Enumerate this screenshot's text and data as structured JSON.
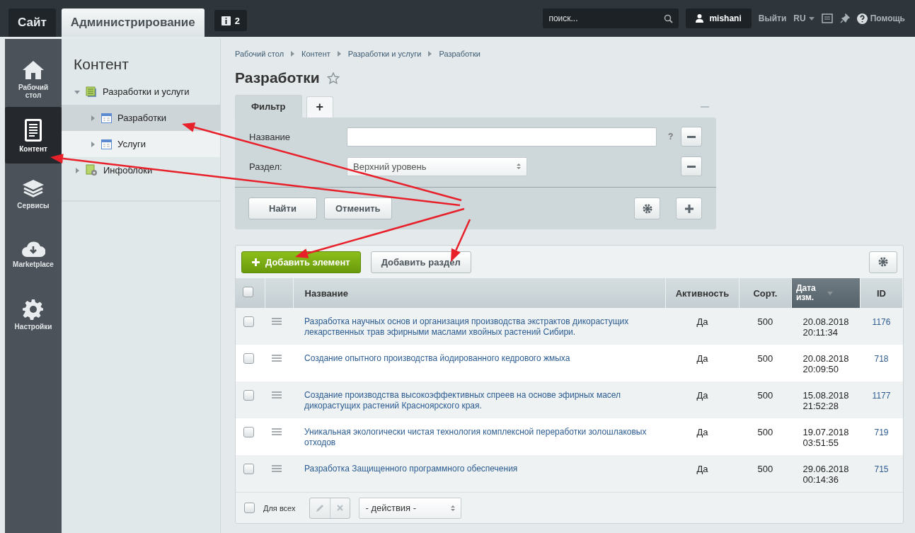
{
  "top_bar": {
    "tabs": [
      {
        "label": "Сайт",
        "selected": false
      },
      {
        "label": "Администрирование",
        "selected": true
      }
    ],
    "notifications": {
      "count": "2"
    },
    "search": {
      "placeholder": "поиск..."
    },
    "user": "mishani",
    "logout": "Выйти",
    "language": "RU",
    "help": "Помощь"
  },
  "main_menu": {
    "items": [
      {
        "label": "Рабочий стол",
        "selected": false
      },
      {
        "label": "Контент",
        "selected": true
      },
      {
        "label": "Сервисы",
        "selected": false
      },
      {
        "label": "Marketplace",
        "selected": false
      },
      {
        "label": "Настройки",
        "selected": false
      }
    ]
  },
  "section_tree": {
    "title": "Контент",
    "items": [
      {
        "label": "Разработки и услуги",
        "expanded": true,
        "selected": false,
        "children": [
          {
            "label": "Разработки",
            "expanded": false,
            "selected": true
          },
          {
            "label": "Услуги",
            "expanded": false,
            "selected": false
          }
        ]
      },
      {
        "label": "Инфоблоки",
        "expanded": false,
        "selected": false
      }
    ]
  },
  "breadcrumbs": [
    "Рабочий стол",
    "Контент",
    "Разработки и услуги",
    "Разработки"
  ],
  "page_title": "Разработки",
  "filter": {
    "tabs": [
      {
        "label": "Фильтр",
        "selected": true
      },
      {
        "label": "+",
        "selected": false
      }
    ],
    "fields": [
      {
        "label": "Название",
        "kind": "text",
        "help": "?"
      },
      {
        "label": "Раздел:",
        "kind": "select",
        "value": "Верхний уровень"
      }
    ],
    "buttons": [
      "Найти",
      "Отменить"
    ]
  },
  "list": {
    "header_checked": false,
    "toolbar": [
      {
        "label": "Добавить элемент",
        "kind": "primary"
      },
      {
        "label": "Добавить раздел",
        "kind": "default"
      }
    ],
    "columns": [
      {
        "label": "Название",
        "sorted": false
      },
      {
        "label": "Активность",
        "sorted": false
      },
      {
        "label": "Сорт.",
        "sorted": false
      },
      {
        "label": "Дата изм.",
        "sorted": true
      },
      {
        "label": "ID",
        "sorted": false
      }
    ],
    "rows": [
      {
        "checked": false,
        "name": "Разработка научных основ и организация производства экстрактов дикорастущих лекарственных трав эфирными маслами хвойных растений Сибири.",
        "active": "Да",
        "sort": "500",
        "date": "20.08.2018",
        "time": "20:11:34",
        "id": "1176"
      },
      {
        "checked": false,
        "name": "Создание опытного производства йодированного кедрового жмыха",
        "active": "Да",
        "sort": "500",
        "date": "20.08.2018",
        "time": "20:09:50",
        "id": "718"
      },
      {
        "checked": false,
        "name": "Создание производства высокоэффективных спреев на основе эфирных масел дикорастущих растений Красноярского края.",
        "active": "Да",
        "sort": "500",
        "date": "15.08.2018",
        "time": "21:52:28",
        "id": "1177"
      },
      {
        "checked": false,
        "name": "Уникальная экологически чистая технология комплексной переработки золошлаковых отходов",
        "active": "Да",
        "sort": "500",
        "date": "19.07.2018",
        "time": "03:51:55",
        "id": "719"
      },
      {
        "checked": false,
        "name": "Разработка Защищенного программного обеспечения",
        "active": "Да",
        "sort": "500",
        "date": "29.06.2018",
        "time": "00:14:36",
        "id": "715"
      }
    ],
    "footer": {
      "for_all": {
        "label": "Для всех",
        "checked": false
      },
      "actions": "- действия -"
    }
  }
}
